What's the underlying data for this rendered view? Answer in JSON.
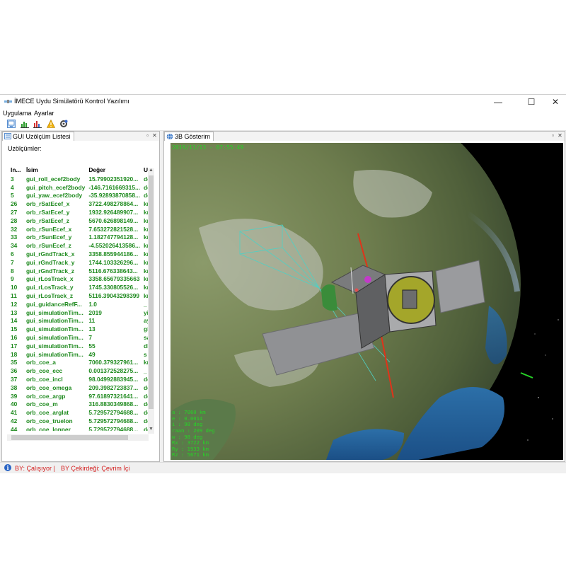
{
  "window": {
    "title": "İMECE Uydu Simülatörü Kontrol Yazılımı",
    "minimize": "—",
    "maximize": "☐",
    "close": "✕"
  },
  "menu": [
    {
      "label": "Uygulama"
    },
    {
      "label": "Ayarlar"
    }
  ],
  "toolbar": [
    {
      "icon": "monitor-icon"
    },
    {
      "icon": "bar-chart-green-icon"
    },
    {
      "icon": "bar-chart-red-icon"
    },
    {
      "icon": "warning-icon"
    },
    {
      "icon": "satellite-settings-icon"
    }
  ],
  "left_panel": {
    "tab_label": "GUI Uzölçüm Listesi",
    "section_label": "Uzölçümler:",
    "columns": [
      "In...",
      "İsim",
      "Değer",
      "U"
    ],
    "rows": [
      {
        "index": "3",
        "name": "gui_roll_ecef2body",
        "value": "15.79902351920...",
        "unit": "de"
      },
      {
        "index": "4",
        "name": "gui_pitch_ecef2body",
        "value": "-146.7161669315...",
        "unit": "de"
      },
      {
        "index": "5",
        "name": "gui_yaw_ecef2body",
        "value": "-35.92893870858...",
        "unit": "de"
      },
      {
        "index": "26",
        "name": "orb_rSatEcef_x",
        "value": "3722.498278864...",
        "unit": "kr"
      },
      {
        "index": "27",
        "name": "orb_rSatEcef_y",
        "value": "1932.926489907...",
        "unit": "kr"
      },
      {
        "index": "28",
        "name": "orb_rSatEcef_z",
        "value": "5670.626898149...",
        "unit": "kr"
      },
      {
        "index": "32",
        "name": "orb_rSunEcef_x",
        "value": "7.653272821528...",
        "unit": "kr"
      },
      {
        "index": "33",
        "name": "orb_rSunEcef_y",
        "value": "1.182747794128...",
        "unit": "kr"
      },
      {
        "index": "34",
        "name": "orb_rSunEcef_z",
        "value": "-4.552026413586...",
        "unit": "kr"
      },
      {
        "index": "6",
        "name": "gui_rGndTrack_x",
        "value": "3358.855944186...",
        "unit": "kr"
      },
      {
        "index": "7",
        "name": "gui_rGndTrack_y",
        "value": "1744.103326296...",
        "unit": "kr"
      },
      {
        "index": "8",
        "name": "gui_rGndTrack_z",
        "value": "5116.676338643...",
        "unit": "kr"
      },
      {
        "index": "9",
        "name": "gui_rLosTrack_x",
        "value": "3358.65679335663",
        "unit": "kr"
      },
      {
        "index": "10",
        "name": "gui_rLosTrack_y",
        "value": "1745.330805526...",
        "unit": "kr"
      },
      {
        "index": "11",
        "name": "gui_rLosTrack_z",
        "value": "5116.39043298399",
        "unit": "kr"
      },
      {
        "index": "12",
        "name": "gui_guidanceRefF...",
        "value": "1.0",
        "unit": "_"
      },
      {
        "index": "13",
        "name": "gui_simulationTim...",
        "value": "2019",
        "unit": "yi"
      },
      {
        "index": "14",
        "name": "gui_simulationTim...",
        "value": "11",
        "unit": "ay"
      },
      {
        "index": "15",
        "name": "gui_simulationTim...",
        "value": "13",
        "unit": "gi"
      },
      {
        "index": "16",
        "name": "gui_simulationTim...",
        "value": "7",
        "unit": "sa"
      },
      {
        "index": "17",
        "name": "gui_simulationTim...",
        "value": "55",
        "unit": "dk"
      },
      {
        "index": "18",
        "name": "gui_simulationTim...",
        "value": "49",
        "unit": "s"
      },
      {
        "index": "35",
        "name": "orb_coe_a",
        "value": "7060.379327961...",
        "unit": "kr"
      },
      {
        "index": "36",
        "name": "orb_coe_ecc",
        "value": "0.001372528275...",
        "unit": "_"
      },
      {
        "index": "37",
        "name": "orb_coe_incl",
        "value": "98.04992883945...",
        "unit": "de"
      },
      {
        "index": "38",
        "name": "orb_coe_omega",
        "value": "209.3982723837...",
        "unit": "de"
      },
      {
        "index": "39",
        "name": "orb_coe_argp",
        "value": "97.61897321641...",
        "unit": "de"
      },
      {
        "index": "40",
        "name": "orb_coe_m",
        "value": "316.8830349868...",
        "unit": "de"
      },
      {
        "index": "41",
        "name": "orb_coe_arglat",
        "value": "5.729572794688...",
        "unit": "de"
      },
      {
        "index": "42",
        "name": "orb_coe_truelon",
        "value": "5.729572794688...",
        "unit": "de"
      },
      {
        "index": "44",
        "name": "orb_coe_lonper",
        "value": "5.729572794688...",
        "unit": "de"
      }
    ]
  },
  "right_panel": {
    "tab_label": "3B Gösterim",
    "timestamp": "2019/11/13 - 07:55:49",
    "overlay": [
      "a : 7060 km",
      "e : 0.0014",
      "i : 98 deg",
      "raan : 209 deg",
      "w : 98 deg",
      "Rx : 3722 km",
      "Ry : 1933 km",
      "Rz : 5671 km"
    ]
  },
  "status": {
    "text1": "BY: Çalışıyor |",
    "text2": "BY Çekirdeği: Çevrim İçi"
  }
}
